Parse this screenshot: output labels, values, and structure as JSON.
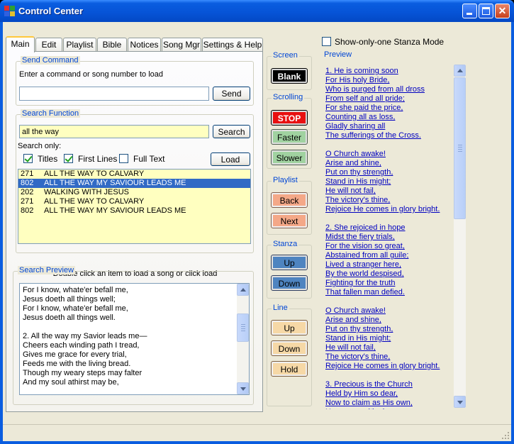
{
  "window": {
    "title": "Control Center"
  },
  "tabs": [
    "Main",
    "Edit",
    "Playlist",
    "Bible",
    "Notices",
    "Song Mgr",
    "Settings & Help"
  ],
  "send_command": {
    "group_label": "Send Command",
    "instruction": "Enter a command or song number to load",
    "value": "",
    "send_label": "Send"
  },
  "search_function": {
    "group_label": "Search Function",
    "query": "all the way",
    "search_label": "Search",
    "search_only_label": "Search only:",
    "titles_label": "Titles",
    "titles_checked": true,
    "first_lines_label": "First Lines",
    "first_lines_checked": true,
    "full_text_label": "Full Text",
    "full_text_checked": false,
    "load_label": "Load",
    "results": [
      {
        "num": "271",
        "title": "ALL THE WAY TO CALVARY",
        "selected": false
      },
      {
        "num": "802",
        "title": "ALL THE WAY MY SAVIOUR LEADS ME",
        "selected": true
      },
      {
        "num": "202",
        "title": "WALKING WITH JESUS",
        "selected": false
      },
      {
        "num": "271",
        "title": "ALL THE WAY TO CALVARY",
        "selected": false
      },
      {
        "num": "802",
        "title": "ALL THE WAY MY SAVIOUR LEADS ME",
        "selected": false
      }
    ],
    "hint": "Double click an item to load a song or click load"
  },
  "search_preview": {
    "group_label": "Search Preview",
    "lines": [
      "For I know, whate'er befall me,",
      "Jesus doeth all things well;",
      "For I know, whate'er befall me,",
      "Jesus doeth all things well.",
      "",
      "2. All the way my Savior leads me—",
      "Cheers each winding path I tread,",
      "Gives me grace for every trial,",
      "Feeds me with the living bread.",
      "Though my weary steps may falter",
      "And my soul athirst may be,"
    ]
  },
  "controls": {
    "screen_label": "Screen",
    "blank_label": "Blank",
    "scrolling_label": "Scrolling",
    "stop_label": "STOP",
    "faster_label": "Faster",
    "slower_label": "Slower",
    "playlist_label": "Playlist",
    "back_label": "Back",
    "next_label": "Next",
    "stanza_label": "Stanza",
    "stanza_up_label": "Up",
    "stanza_down_label": "Down",
    "line_label": "Line",
    "line_up_label": "Up",
    "line_down_label": "Down",
    "hold_label": "Hold"
  },
  "stanza_mode": {
    "label": "Show-only-one Stanza Mode",
    "checked": false
  },
  "preview": {
    "group_label": "Preview",
    "stanzas": [
      [
        "1. He is coming soon",
        "For His holy Bride,",
        "Who is purged from all dross",
        "From self and all pride;",
        "For she paid the price,",
        "Counting all as loss,",
        "Gladly sharing all",
        "The sufferings of the Cross."
      ],
      [
        "O Church awake!",
        "Arise and shine,",
        "Put on thy strength,",
        "Stand in His might;",
        "He will not fail,",
        "The victory's thine,",
        "Rejoice He comes in glory bright."
      ],
      [
        "2. She rejoiced in hope",
        "Midst the fiery trials,",
        "For the vision so great,",
        "Abstained from all guile;",
        "Lived a stranger here,",
        "By the world despised,",
        "Fighting for the truth",
        "That fallen man defied."
      ],
      [
        "O Church awake!",
        "Arise and shine,",
        "Put on thy strength,",
        "Stand in His might;",
        "He will not fail,",
        "The victory's thine,",
        "Rejoice He comes in glory bright."
      ],
      [
        "3. Precious is the Church",
        "Held by Him so dear,",
        "Now to claim as His own,",
        "He comes with cheer"
      ]
    ]
  }
}
